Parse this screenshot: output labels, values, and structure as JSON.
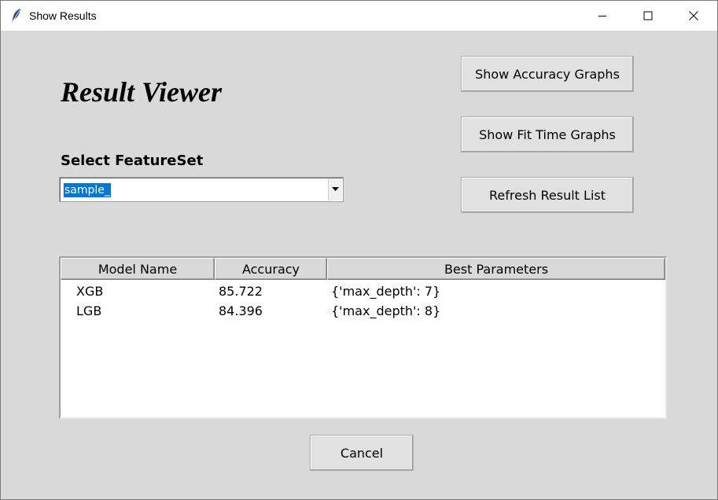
{
  "window": {
    "title": "Show Results",
    "icon": "feather-icon",
    "controls": [
      "minimize-icon",
      "maximize-icon",
      "close-icon"
    ]
  },
  "heading": "Result Viewer",
  "featureset": {
    "label": "Select FeatureSet",
    "selected_value": "sample_"
  },
  "buttons": {
    "accuracy_graphs": "Show Accuracy Graphs",
    "fit_time_graphs": "Show Fit Time Graphs",
    "refresh": "Refresh Result List",
    "cancel": "Cancel"
  },
  "results_table": {
    "columns": [
      "Model Name",
      "Accuracy",
      "Best Parameters"
    ],
    "rows": [
      [
        "XGB",
        "85.722",
        "{'max_depth': 7}"
      ],
      [
        "LGB",
        "84.396",
        "{'max_depth': 8}"
      ]
    ]
  },
  "colors": {
    "background": "#d9d9d9",
    "selection": "#0078d7",
    "button": "#e1e1e1"
  }
}
